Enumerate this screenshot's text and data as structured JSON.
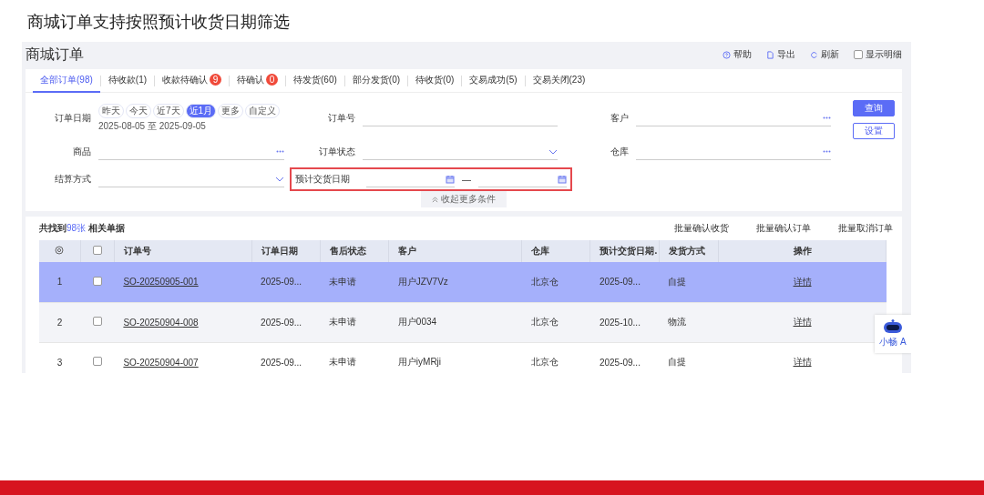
{
  "slide_title": "商城订单支持按照预计收货日期筛选",
  "page": {
    "title": "商城订单",
    "tools": [
      {
        "kind": "help",
        "label": "帮助"
      },
      {
        "kind": "export",
        "label": "导出"
      },
      {
        "kind": "refresh",
        "label": "刷新"
      },
      {
        "kind": "checkbox",
        "label": "显示明细",
        "checked": false
      }
    ],
    "tabs": [
      {
        "label": "全部订单(98)",
        "selected": true
      },
      {
        "label": "待收款(1)",
        "selected": false
      },
      {
        "label": "收款待确认",
        "badge": "9",
        "selected": false
      },
      {
        "label": "待确认",
        "badge": "0",
        "selected": false
      },
      {
        "label": "待发货(60)",
        "selected": false
      },
      {
        "label": "部分发货(0)",
        "selected": false
      },
      {
        "label": "待收货(0)",
        "selected": false
      },
      {
        "label": "交易成功(5)",
        "selected": false
      },
      {
        "label": "交易关闭(23)",
        "selected": false
      }
    ],
    "filters": [
      {
        "kind": "date-chips",
        "label": "订单日期",
        "chips": [
          {
            "label": "昨天",
            "selected": false
          },
          {
            "label": "今天",
            "selected": false
          },
          {
            "label": "近7天",
            "selected": false
          },
          {
            "label": "近1月",
            "selected": true
          },
          {
            "label": "更多",
            "selected": false
          },
          {
            "label": "自定义",
            "selected": false
          }
        ],
        "range": "2025-08-05 至 2025-09-05"
      },
      {
        "kind": "text",
        "label": "订单号"
      },
      {
        "kind": "more",
        "label": "客户"
      },
      {
        "kind": "more",
        "label": "商品"
      },
      {
        "kind": "select",
        "label": "订单状态"
      },
      {
        "kind": "more",
        "label": "仓库"
      },
      {
        "kind": "select",
        "label": "结算方式"
      },
      {
        "kind": "date-range",
        "label": "预计交货日期",
        "separator": "—",
        "highlighted": true
      }
    ],
    "buttons": [
      {
        "kind": "primary",
        "label": "查询"
      },
      {
        "kind": "outline",
        "label": "设置"
      }
    ],
    "collapse": "收起更多条件",
    "summary": {
      "prefix": "共找到",
      "count": "98张",
      "suffix": " 相关单据"
    },
    "batch_actions": [
      "批量确认收货",
      "批量确认订单",
      "批量取消订单"
    ],
    "table": {
      "select_all": {
        "checked": false
      },
      "columns": [
        "订单号",
        "订单日期",
        "售后状态",
        "客户",
        "仓库",
        "预计交货日期.",
        "发货方式",
        "操作"
      ],
      "rows": [
        {
          "index": "1",
          "checked": false,
          "selected": true,
          "order": "SO-20250905-001",
          "date": "2025-09...",
          "after_sale": "未申请",
          "customer": "用户JZV7Vz",
          "warehouse": "北京仓",
          "delivery_date": "2025-09...",
          "shipping": "自提",
          "action": "详情"
        },
        {
          "index": "2",
          "checked": false,
          "selected": false,
          "order": "SO-20250904-008",
          "date": "2025-09...",
          "after_sale": "未申请",
          "customer": "用户0034",
          "warehouse": "北京仓",
          "delivery_date": "2025-10...",
          "shipping": "物流",
          "action": "详情"
        },
        {
          "index": "3",
          "checked": false,
          "selected": false,
          "order": "SO-20250904-007",
          "date": "2025-09...",
          "after_sale": "未申请",
          "customer": "用户iyMRji",
          "warehouse": "北京仓",
          "delivery_date": "2025-09...",
          "shipping": "自提",
          "action": "详情"
        }
      ]
    },
    "assistant": {
      "label": "小畅 A"
    }
  }
}
